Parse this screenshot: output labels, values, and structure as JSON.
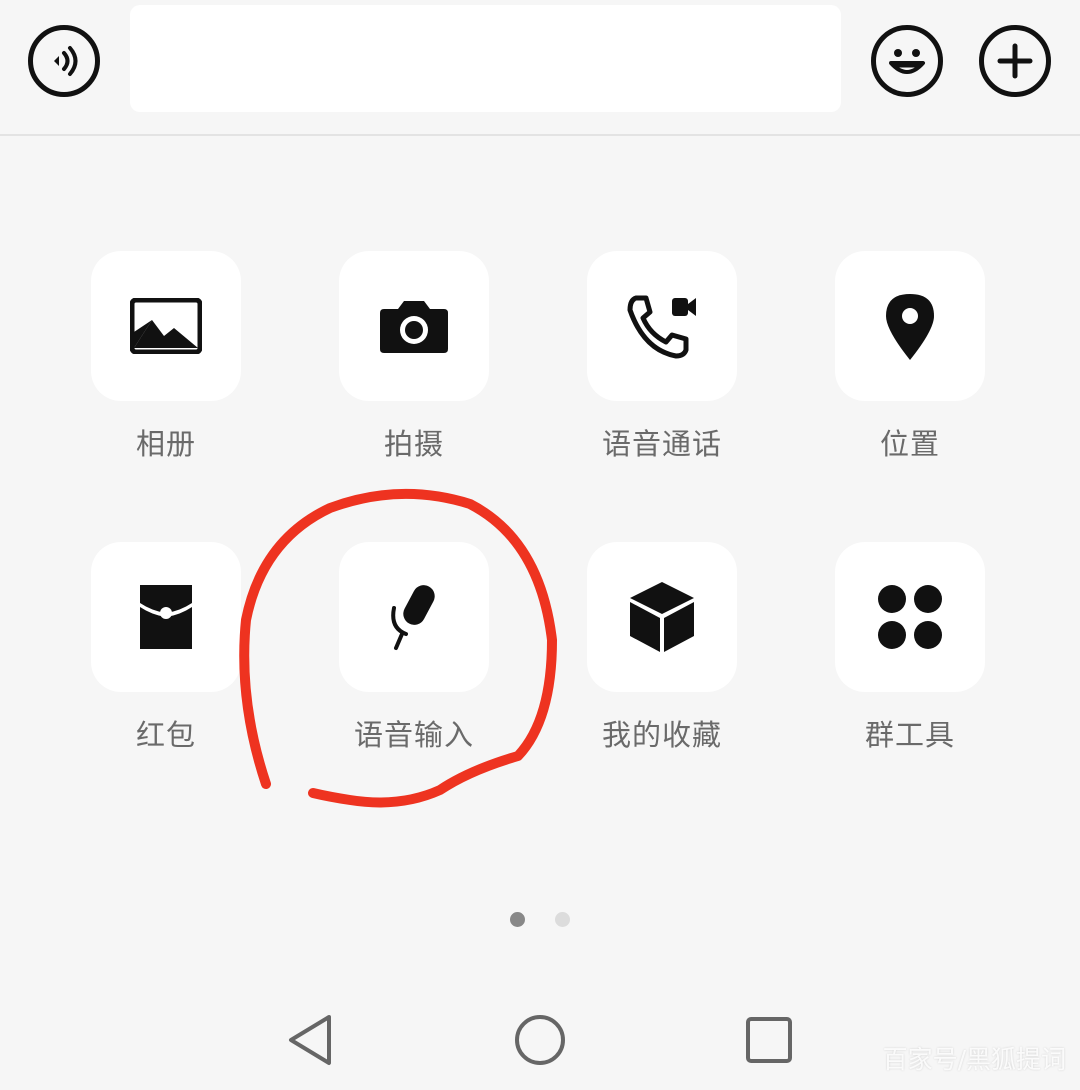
{
  "top_bar": {
    "voice_toggle_icon": "voice-toggle-icon",
    "message_input_value": "",
    "emoji_icon": "emoji-icon",
    "more_icon": "plus-icon"
  },
  "panel": {
    "items": [
      {
        "label": "相册",
        "icon": "photo-album-icon"
      },
      {
        "label": "拍摄",
        "icon": "camera-icon"
      },
      {
        "label": "语音通话",
        "icon": "voice-call-icon"
      },
      {
        "label": "位置",
        "icon": "location-pin-icon"
      },
      {
        "label": "红包",
        "icon": "red-packet-icon"
      },
      {
        "label": "语音输入",
        "icon": "microphone-icon"
      },
      {
        "label": "我的收藏",
        "icon": "favorites-cube-icon"
      },
      {
        "label": "群工具",
        "icon": "group-tools-icon"
      }
    ],
    "page_indicator": {
      "current_page": 1,
      "total_pages": 2
    }
  },
  "nav_bar": {
    "back_icon": "back-triangle-icon",
    "home_icon": "home-circle-icon",
    "recents_icon": "recents-square-icon"
  },
  "watermark": "百家号/黑狐提词",
  "annotation": {
    "color": "#ee3320",
    "description_target": "语音输入"
  }
}
